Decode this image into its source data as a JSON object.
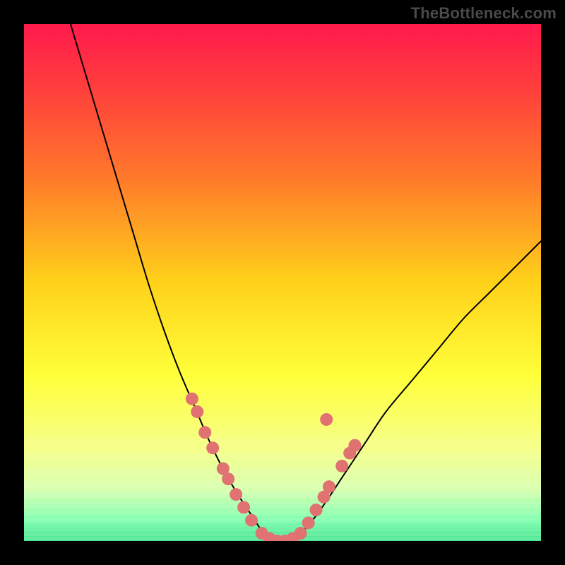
{
  "watermark": "TheBottleneck.com",
  "chart_data": {
    "type": "line",
    "title": "",
    "xlabel": "",
    "ylabel": "",
    "xlim": [
      0,
      100
    ],
    "ylim": [
      0,
      100
    ],
    "gradient_stops": [
      {
        "offset": 0.0,
        "color": "#ff1a4d"
      },
      {
        "offset": 0.12,
        "color": "#ff3d3d"
      },
      {
        "offset": 0.3,
        "color": "#ff7a2a"
      },
      {
        "offset": 0.5,
        "color": "#ffd21a"
      },
      {
        "offset": 0.68,
        "color": "#ffff3a"
      },
      {
        "offset": 0.82,
        "color": "#f6ff8a"
      },
      {
        "offset": 0.9,
        "color": "#d9ffb0"
      },
      {
        "offset": 0.96,
        "color": "#7dffad"
      },
      {
        "offset": 1.0,
        "color": "#22e07a"
      }
    ],
    "series": [
      {
        "name": "left-curve",
        "type": "line",
        "x": [
          9,
          12,
          15,
          18,
          21,
          24,
          27,
          30,
          33,
          36,
          39,
          42,
          44,
          46,
          48
        ],
        "y": [
          100,
          90,
          80,
          70,
          60,
          50,
          41,
          33,
          26,
          19,
          13,
          8,
          5,
          2,
          0
        ]
      },
      {
        "name": "right-curve",
        "type": "line",
        "x": [
          52,
          55,
          58,
          62,
          66,
          70,
          75,
          80,
          85,
          90,
          95,
          100
        ],
        "y": [
          0,
          3,
          7,
          13,
          19,
          25,
          31,
          37,
          43,
          48,
          53,
          58
        ]
      },
      {
        "name": "floor",
        "type": "line",
        "x": [
          48,
          52
        ],
        "y": [
          0,
          0
        ]
      }
    ],
    "markers": {
      "name": "data-points",
      "color": "#e07272",
      "points": [
        {
          "x": 32.5,
          "y": 27.5
        },
        {
          "x": 33.5,
          "y": 25.0
        },
        {
          "x": 35.0,
          "y": 21.0
        },
        {
          "x": 36.5,
          "y": 18.0
        },
        {
          "x": 38.5,
          "y": 14.0
        },
        {
          "x": 39.5,
          "y": 12.0
        },
        {
          "x": 41.0,
          "y": 9.0
        },
        {
          "x": 42.5,
          "y": 6.5
        },
        {
          "x": 44.0,
          "y": 4.0
        },
        {
          "x": 46.0,
          "y": 1.5
        },
        {
          "x": 47.5,
          "y": 0.5
        },
        {
          "x": 49.0,
          "y": 0.0
        },
        {
          "x": 50.5,
          "y": 0.0
        },
        {
          "x": 52.0,
          "y": 0.5
        },
        {
          "x": 53.5,
          "y": 1.5
        },
        {
          "x": 55.0,
          "y": 3.5
        },
        {
          "x": 56.5,
          "y": 6.0
        },
        {
          "x": 58.0,
          "y": 8.5
        },
        {
          "x": 59.0,
          "y": 10.5
        },
        {
          "x": 61.5,
          "y": 14.5
        },
        {
          "x": 63.0,
          "y": 17.0
        },
        {
          "x": 64.0,
          "y": 18.5
        },
        {
          "x": 58.5,
          "y": 23.5
        }
      ]
    }
  }
}
